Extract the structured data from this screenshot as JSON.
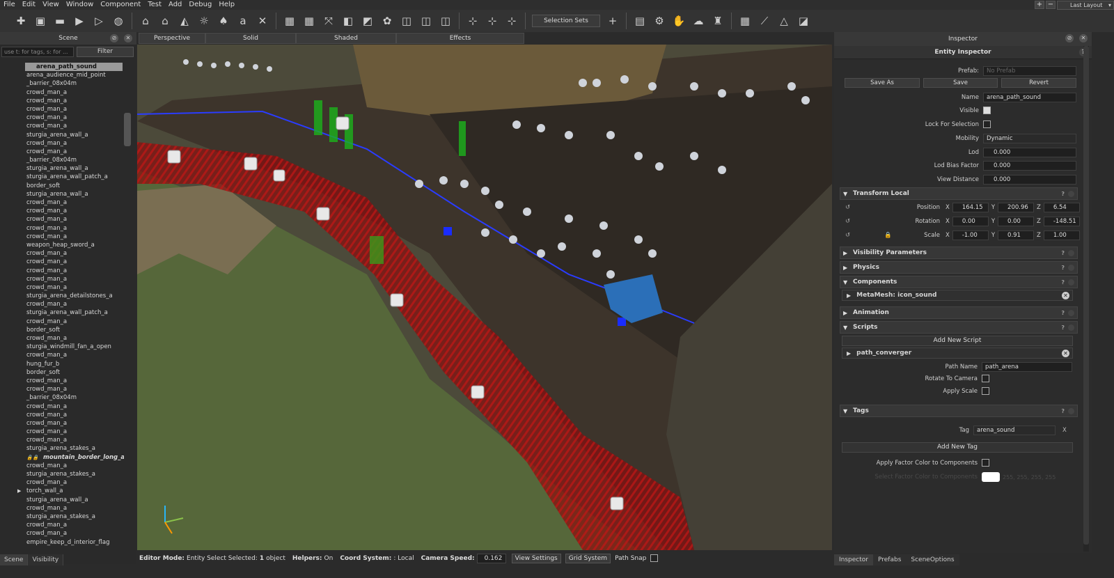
{
  "menu": [
    "File",
    "Edit",
    "View",
    "Window",
    "Component",
    "Test",
    "Add",
    "Debug",
    "Help"
  ],
  "layout": {
    "plus": "+",
    "minus": "−",
    "value": "Last Layout"
  },
  "toolbar": {
    "selection_sets": "Selection Sets",
    "add": "+"
  },
  "scene": {
    "title": "Scene",
    "filter_placeholder": "use t: for tags, s: for ...",
    "filter_button": "Filter",
    "items": [
      "arena_path_sound",
      "arena_audience_mid_point",
      "_barrier_08x04m",
      "crowd_man_a",
      "crowd_man_a",
      "crowd_man_a",
      "crowd_man_a",
      "crowd_man_a",
      "sturgia_arena_wall_a",
      "crowd_man_a",
      "crowd_man_a",
      "_barrier_08x04m",
      "sturgia_arena_wall_a",
      "sturgia_arena_wall_patch_a",
      "border_soft",
      "sturgia_arena_wall_a",
      "crowd_man_a",
      "crowd_man_a",
      "crowd_man_a",
      "crowd_man_a",
      "crowd_man_a",
      "weapon_heap_sword_a",
      "crowd_man_a",
      "crowd_man_a",
      "crowd_man_a",
      "crowd_man_a",
      "crowd_man_a",
      "sturgia_arena_detailstones_a",
      "crowd_man_a",
      "sturgia_arena_wall_patch_a",
      "crowd_man_a",
      "border_soft",
      "crowd_man_a",
      "sturgia_windmill_fan_a_open",
      "crowd_man_a",
      "hung_fur_b",
      "border_soft",
      "crowd_man_a",
      "crowd_man_a",
      "_barrier_08x04m",
      "crowd_man_a",
      "crowd_man_a",
      "crowd_man_a",
      "crowd_man_a",
      "crowd_man_a",
      "sturgia_arena_stakes_a",
      "mountain_border_long_a",
      "crowd_man_a",
      "sturgia_arena_stakes_a",
      "crowd_man_a",
      "torch_wall_a",
      "sturgia_arena_wall_a",
      "crowd_man_a",
      "sturgia_arena_stakes_a",
      "crowd_man_a",
      "crowd_man_a",
      "empire_keep_d_interior_flag"
    ],
    "tabs": [
      "Scene",
      "Visibility"
    ]
  },
  "viewport": {
    "tabs": [
      "Perspective",
      "Solid",
      "Shaded",
      "Effects"
    ]
  },
  "status": {
    "editor_mode_label": "Editor Mode:",
    "editor_mode_value": "Entity Select Selected:",
    "selected_count": "1",
    "selected_suffix": "object",
    "helpers_label": "Helpers:",
    "helpers_value": "On",
    "coord_label": "Coord System:",
    "coord_value": ": Local",
    "camera_label": "Camera Speed:",
    "camera_value": "0.162",
    "view_settings": "View Settings",
    "grid_system": "Grid System",
    "path_snap": "Path Snap"
  },
  "inspector": {
    "title": "Inspector",
    "entity_title": "Entity Inspector",
    "prefab_label": "Prefab:",
    "prefab_value": "No Prefab",
    "save_as": "Save As",
    "save": "Save",
    "revert": "Revert",
    "name_label": "Name",
    "name_value": "arena_path_sound",
    "visible_label": "Visible",
    "lock_label": "Lock For Selection",
    "mobility_label": "Mobility",
    "mobility_value": "Dynamic",
    "lod_label": "Lod",
    "lod_value": "0.000",
    "lod_bias_label": "Lod Bias Factor",
    "lod_bias_value": "0.000",
    "view_dist_label": "View Distance",
    "view_dist_value": "0.000",
    "transform": {
      "title": "Transform Local",
      "position_label": "Position",
      "rotation_label": "Rotation",
      "scale_label": "Scale",
      "position": [
        "164.15",
        "200.96",
        "6.54"
      ],
      "rotation": [
        "0.00",
        "0.00",
        "-148.51"
      ],
      "scale": [
        "-1.00",
        "0.91",
        "1.00"
      ]
    },
    "axes": [
      "X",
      "Y",
      "Z"
    ],
    "visibility_params": "Visibility Parameters",
    "physics": "Physics",
    "components": "Components",
    "metamesh": "MetaMesh: icon_sound",
    "animation": "Animation",
    "scripts": "Scripts",
    "add_script": "Add New Script",
    "script_name": "path_converger",
    "path_name_label": "Path Name",
    "path_name_value": "path_arena",
    "rotate_cam_label": "Rotate To Camera",
    "apply_scale_label": "Apply Scale",
    "tags": "Tags",
    "tag_label": "Tag",
    "tag_value": "arena_sound",
    "tag_x": "X",
    "add_tag": "Add New Tag",
    "apply_factor_label": "Apply Factor Color to Components",
    "select_factor_label": "Select Factor Color to Components",
    "factor_values": "255, 255, 255, 255",
    "q": "?",
    "tabs": [
      "Inspector",
      "Prefabs",
      "SceneOptions"
    ]
  }
}
